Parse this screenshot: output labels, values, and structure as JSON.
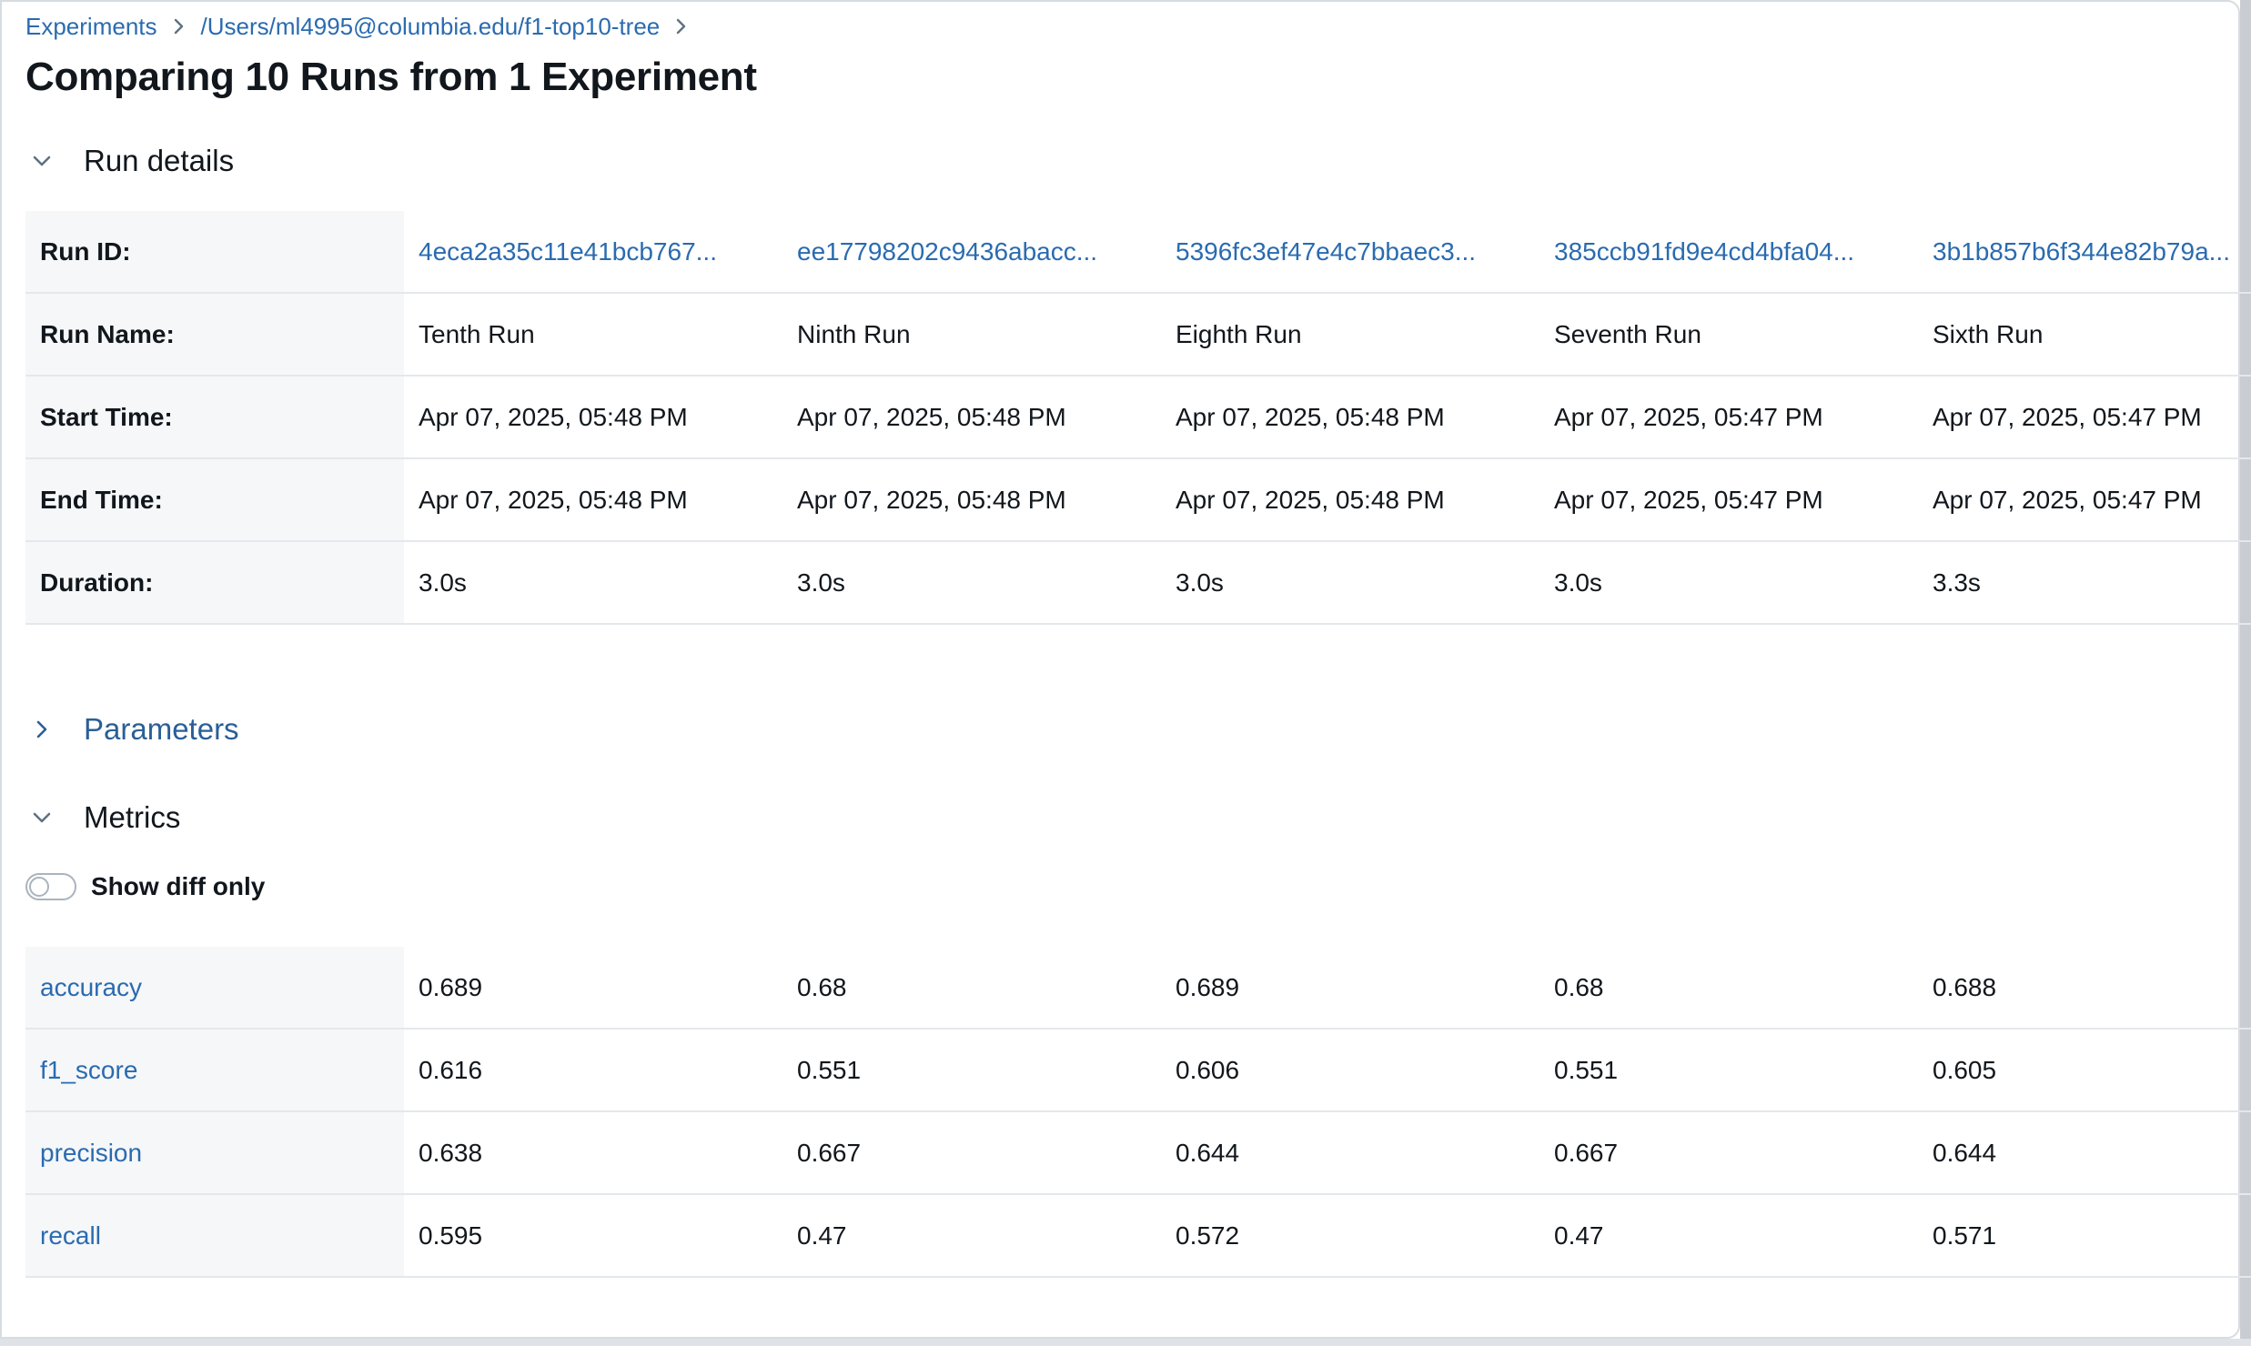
{
  "breadcrumb": {
    "items": [
      "Experiments",
      "/Users/ml4995@columbia.edu/f1-top10-tree"
    ]
  },
  "page": {
    "title": "Comparing 10 Runs from 1 Experiment"
  },
  "sections": {
    "run_details": "Run details",
    "parameters": "Parameters",
    "metrics": "Metrics"
  },
  "run_details": {
    "rows": [
      {
        "label": "Run ID:",
        "values": [
          "4eca2a35c11e41bcb767...",
          "ee17798202c9436abacc...",
          "5396fc3ef47e4c7bbaec3...",
          "385ccb91fd9e4cd4bfa04...",
          "3b1b857b6f344e82b79a..."
        ]
      },
      {
        "label": "Run Name:",
        "values": [
          "Tenth Run",
          "Ninth Run",
          "Eighth Run",
          "Seventh Run",
          "Sixth Run"
        ]
      },
      {
        "label": "Start Time:",
        "values": [
          "Apr 07, 2025, 05:48 PM",
          "Apr 07, 2025, 05:48 PM",
          "Apr 07, 2025, 05:48 PM",
          "Apr 07, 2025, 05:47 PM",
          "Apr 07, 2025, 05:47 PM"
        ]
      },
      {
        "label": "End Time:",
        "values": [
          "Apr 07, 2025, 05:48 PM",
          "Apr 07, 2025, 05:48 PM",
          "Apr 07, 2025, 05:48 PM",
          "Apr 07, 2025, 05:47 PM",
          "Apr 07, 2025, 05:47 PM"
        ]
      },
      {
        "label": "Duration:",
        "values": [
          "3.0s",
          "3.0s",
          "3.0s",
          "3.0s",
          "3.3s"
        ]
      }
    ]
  },
  "metrics": {
    "show_diff_label": "Show diff only",
    "show_diff_on": false,
    "rows": [
      {
        "label": "accuracy",
        "values": [
          "0.689",
          "0.68",
          "0.689",
          "0.68",
          "0.688"
        ]
      },
      {
        "label": "f1_score",
        "values": [
          "0.616",
          "0.551",
          "0.606",
          "0.551",
          "0.605"
        ]
      },
      {
        "label": "precision",
        "values": [
          "0.638",
          "0.667",
          "0.644",
          "0.667",
          "0.644"
        ]
      },
      {
        "label": "recall",
        "values": [
          "0.595",
          "0.47",
          "0.572",
          "0.47",
          "0.571"
        ]
      }
    ]
  },
  "icons": {
    "breadcrumb_separator": "chevron-right-icon",
    "expanded": "chevron-down-icon",
    "collapsed": "chevron-right-icon"
  },
  "colors": {
    "link": "#2a6bb0",
    "header_cell_bg": "#f6f7f9",
    "text": "#11171c",
    "divider": "#e4e8ec"
  }
}
